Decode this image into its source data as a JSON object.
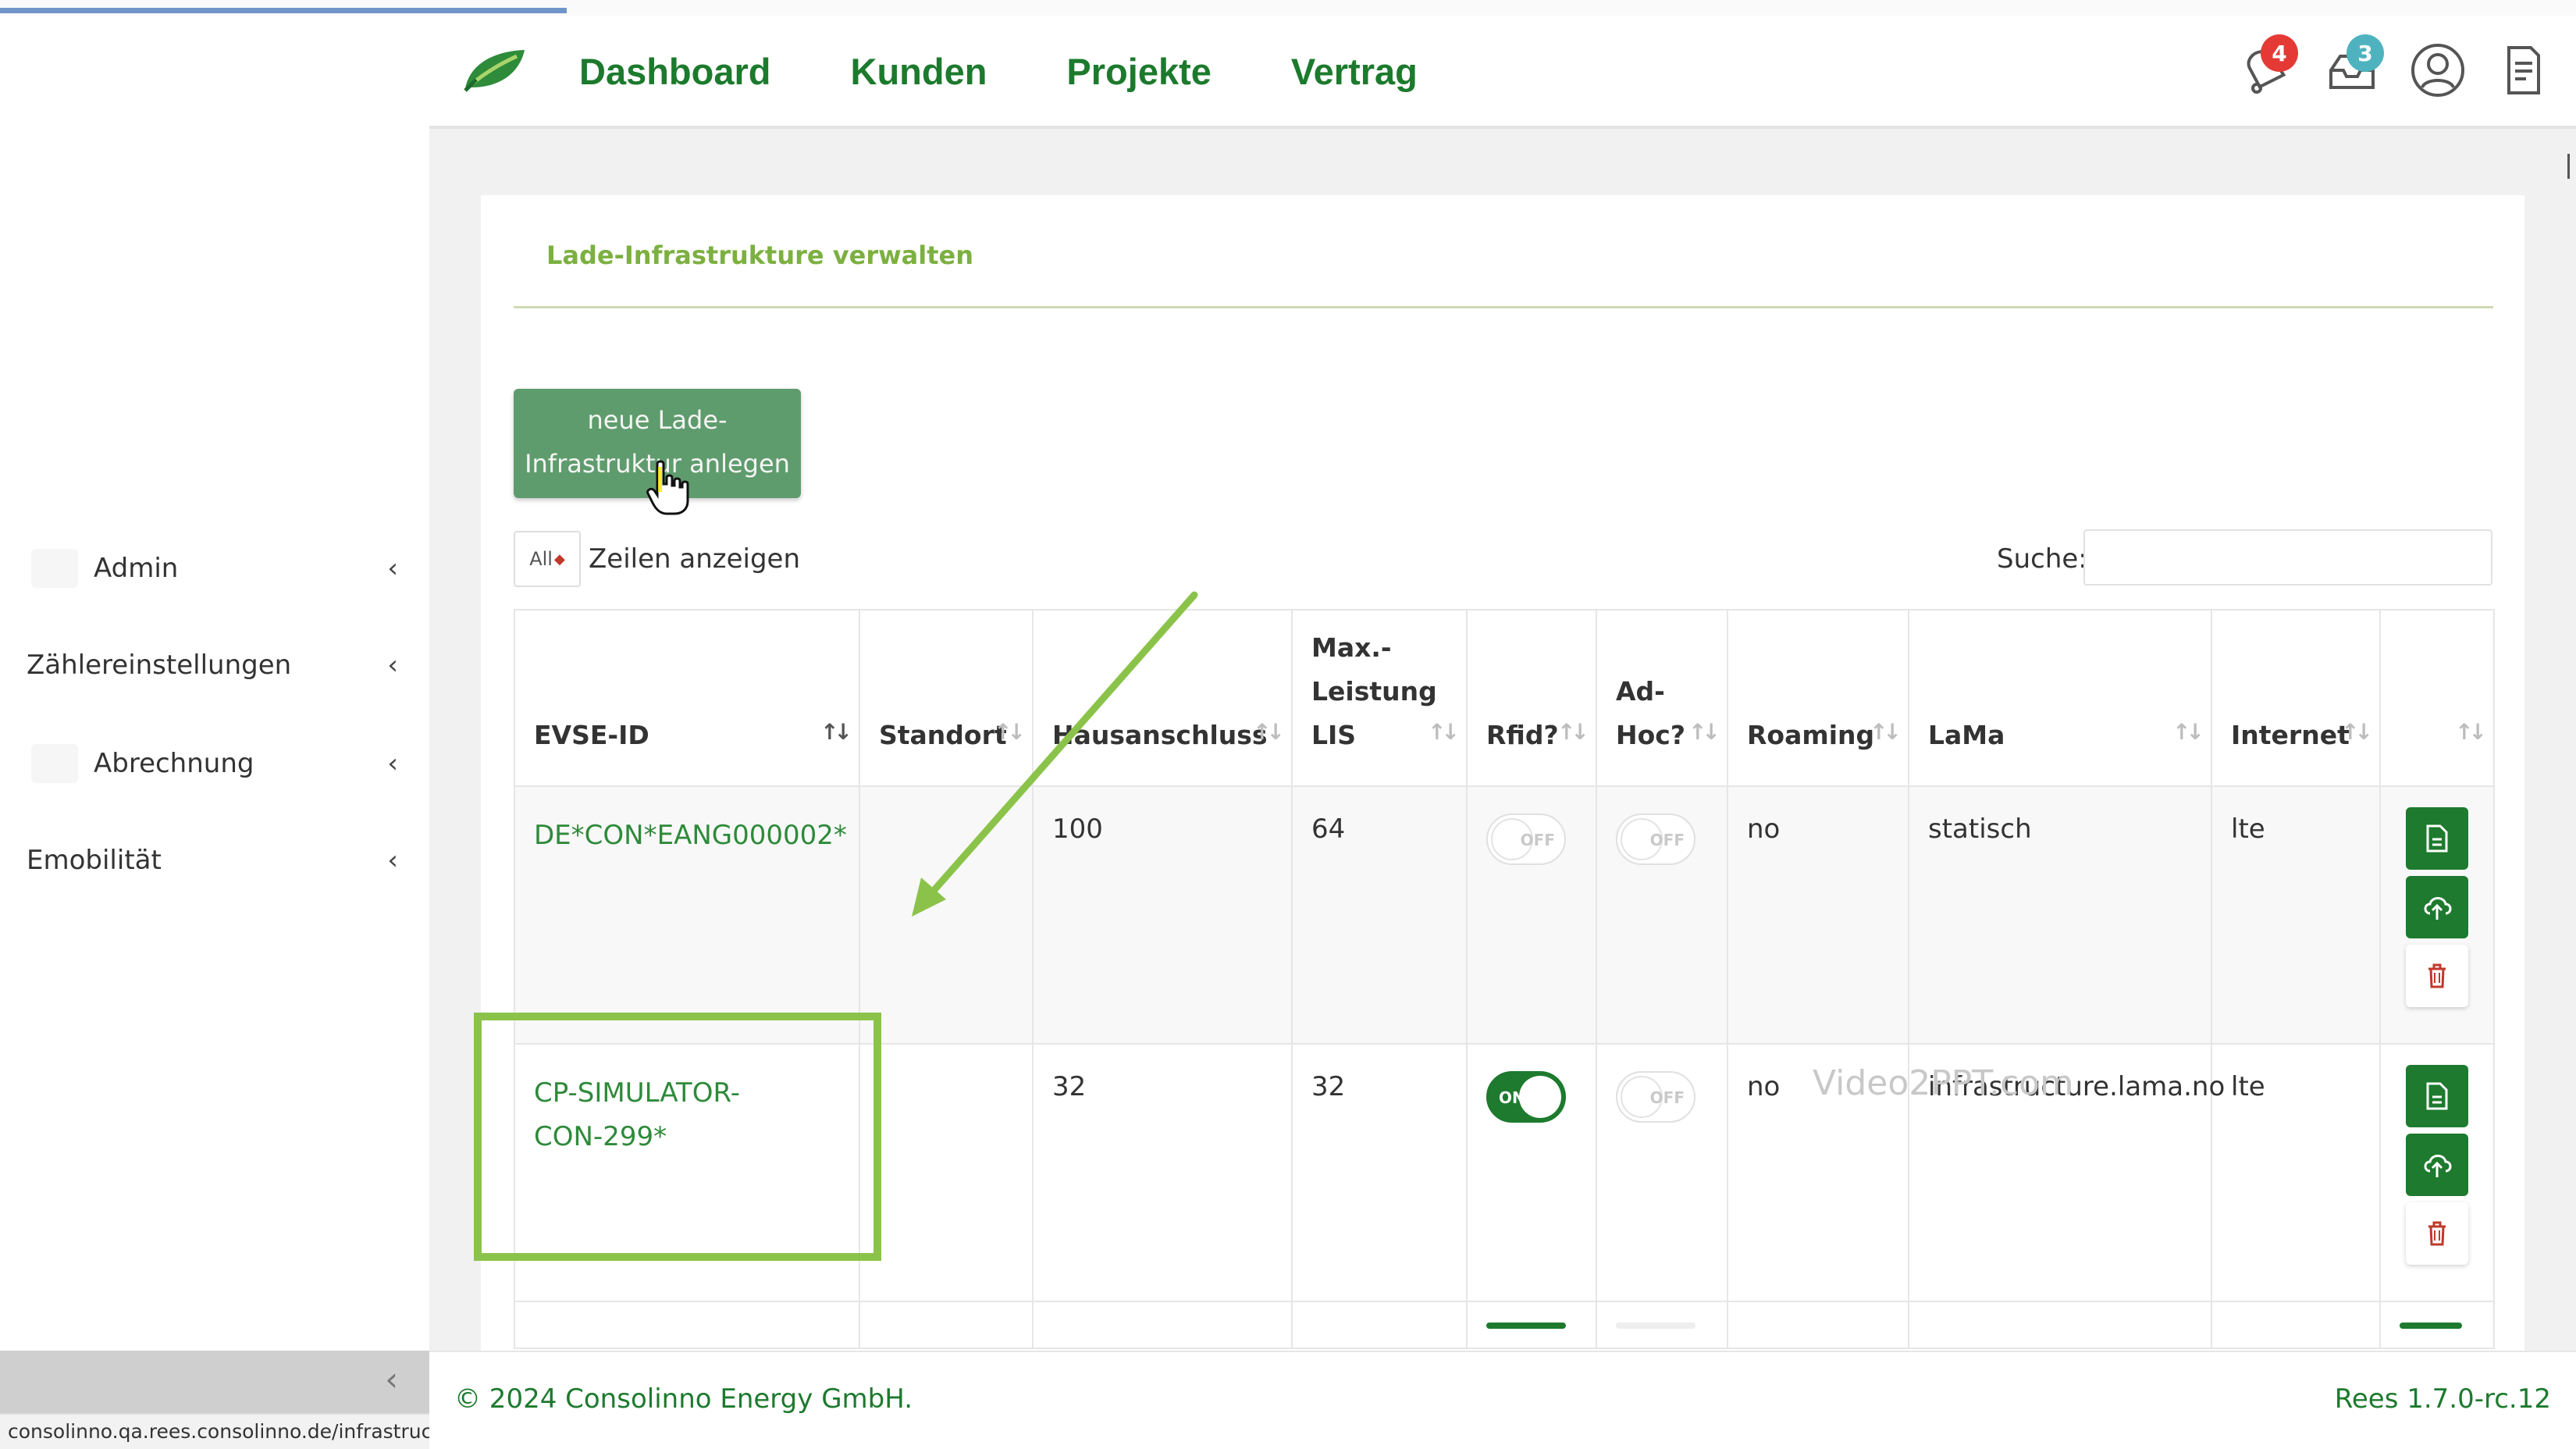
{
  "browser": {
    "progress_fraction": 0.22,
    "status_url": "consolinno.qa.rees.consolinno.de/infrastructure/create"
  },
  "header": {
    "nav": [
      "Dashboard",
      "Kunden",
      "Projekte",
      "Vertrag"
    ],
    "notifications_count": "4",
    "messages_count": "3",
    "icons": [
      "bell-icon",
      "inbox-icon",
      "user-icon",
      "document-icon"
    ]
  },
  "sidebar": {
    "items": [
      {
        "label": "Admin"
      },
      {
        "label": "Zählereinstellungen"
      },
      {
        "label": "Abrechnung"
      },
      {
        "label": "Emobilität"
      }
    ]
  },
  "card": {
    "title": "Lade-Infrastrukture verwalten",
    "new_button_line1": "neue Lade-",
    "new_button_line2": "Infrastruktur anlegen",
    "length_select_value": "All",
    "length_label": "Zeilen anzeigen",
    "search_label": "Suche:",
    "search_value": ""
  },
  "table": {
    "headers": {
      "evse_id": "EVSE-ID",
      "standort": "Standort",
      "hausanschluss": "Hausanschluss",
      "max_line1": "Max.-",
      "max_line2": "Leistung",
      "max_line3": "LIS",
      "rfid": "Rfid?",
      "adhoc_line1": "Ad-",
      "adhoc_line2": "Hoc?",
      "roaming": "Roaming",
      "lama": "LaMa",
      "internet": "Internet"
    },
    "rows": [
      {
        "evse_line1": "DE*CON*EANG000002*",
        "evse_line2": "",
        "standort": "",
        "hausanschluss": "100",
        "max_leistung": "64",
        "rfid": "OFF",
        "adhoc": "OFF",
        "roaming": "no",
        "lama": "statisch",
        "internet": "lte"
      },
      {
        "evse_line1": "CP-SIMULATOR-",
        "evse_line2": "CON-299*",
        "standort": "",
        "hausanschluss": "32",
        "max_leistung": "32",
        "rfid": "ON",
        "adhoc": "OFF",
        "roaming": "no",
        "lama": "infrastructure.lama.no",
        "internet": "lte"
      }
    ]
  },
  "watermark": "Video2PPT.com",
  "footer": {
    "copyright": "© 2024 Consolinno Energy GmbH.",
    "version": "Rees 1.7.0-rc.12"
  },
  "colors": {
    "brand_green": "#1d7a2e",
    "title_green": "#7cb041",
    "button_green": "#5f9c6d",
    "annotation_green": "#8bc34a",
    "badge_red": "#e53935",
    "badge_teal": "#4fb3bf"
  }
}
